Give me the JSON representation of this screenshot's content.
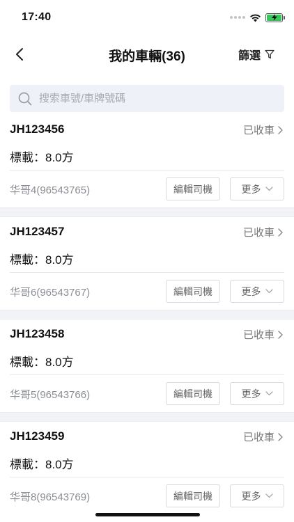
{
  "status_bar": {
    "time": "17:40"
  },
  "nav": {
    "title": "我的車輛(36)",
    "filter_label": "篩選"
  },
  "search": {
    "placeholder": "搜索車號/車牌號碼"
  },
  "vehicles": [
    {
      "plate": "JH123456",
      "status": "已收車",
      "load_label": "標載：",
      "load_value": "8.0方",
      "driver": "华哥4(96543765)",
      "edit_label": "編輯司機",
      "more_label": "更多"
    },
    {
      "plate": "JH123457",
      "status": "已收車",
      "load_label": "標載：",
      "load_value": "8.0方",
      "driver": "华哥6(96543767)",
      "edit_label": "編輯司機",
      "more_label": "更多"
    },
    {
      "plate": "JH123458",
      "status": "已收車",
      "load_label": "標載：",
      "load_value": "8.0方",
      "driver": "华哥5(96543766)",
      "edit_label": "編輯司機",
      "more_label": "更多"
    },
    {
      "plate": "JH123459",
      "status": "已收車",
      "load_label": "標載：",
      "load_value": "8.0方",
      "driver": "华哥8(96543769)",
      "edit_label": "編輯司機",
      "more_label": "更多"
    }
  ],
  "colors": {
    "search_bg": "#eef1f7",
    "battery": "#34c759",
    "divider_bg": "#f1f3f6"
  }
}
